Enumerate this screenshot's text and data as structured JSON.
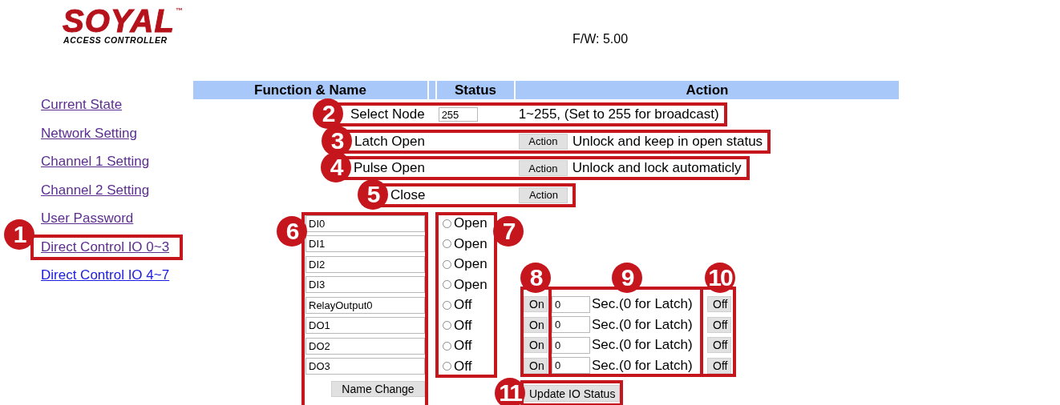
{
  "header": {
    "logo": {
      "brand": "SOYAL",
      "trademark": "™",
      "subtitle": "ACCESS CONTROLLER"
    },
    "firmware": "F/W: 5.00"
  },
  "sidebar": {
    "items": [
      {
        "label": "Current State",
        "visited": true
      },
      {
        "label": "Network Setting",
        "visited": true
      },
      {
        "label": "Channel 1 Setting",
        "visited": true
      },
      {
        "label": "Channel 2 Setting",
        "visited": true
      },
      {
        "label": "User Password",
        "visited": true
      },
      {
        "label": "Direct Control IO 0~3",
        "visited": true,
        "callout": "1"
      },
      {
        "label": "Direct Control IO 4~7",
        "visited": false
      }
    ]
  },
  "table": {
    "columns": [
      "Function & Name",
      "Status",
      "Action"
    ],
    "commands": [
      {
        "kind": "input",
        "label": "Select Node",
        "value": "255",
        "description": "1~255, (Set to 255 for broadcast)",
        "callout": "2"
      },
      {
        "kind": "action",
        "label": "Latch Open",
        "button": "Action",
        "description": "Unlock and keep in open status",
        "callout": "3"
      },
      {
        "kind": "action",
        "label": "Pulse Open",
        "button": "Action",
        "description": "Unlock and lock automaticly",
        "callout": "4"
      },
      {
        "kind": "action",
        "label": "Close",
        "button": "Action",
        "callout": "5"
      }
    ]
  },
  "io": {
    "rows": [
      {
        "kind": "input",
        "name": "DI0",
        "status": "Open",
        "checked": false
      },
      {
        "kind": "input",
        "name": "DI1",
        "status": "Open",
        "checked": false
      },
      {
        "kind": "input",
        "name": "DI2",
        "status": "Open",
        "checked": false
      },
      {
        "kind": "input",
        "name": "DI3",
        "status": "Open",
        "checked": false
      },
      {
        "kind": "output",
        "name": "RelayOutput0",
        "status": "Off",
        "checked": false,
        "on": "On",
        "seconds": "0",
        "unit": "Sec.(0 for Latch)",
        "off": "Off"
      },
      {
        "kind": "output",
        "name": "DO1",
        "status": "Off",
        "checked": false,
        "on": "On",
        "seconds": "0",
        "unit": "Sec.(0 for Latch)",
        "off": "Off"
      },
      {
        "kind": "output",
        "name": "DO2",
        "status": "Off",
        "checked": false,
        "on": "On",
        "seconds": "0",
        "unit": "Sec.(0 for Latch)",
        "off": "Off"
      },
      {
        "kind": "output",
        "name": "DO3",
        "status": "Off",
        "checked": false,
        "on": "On",
        "seconds": "0",
        "unit": "Sec.(0 for Latch)",
        "off": "Off"
      }
    ],
    "name_change": "Name Change",
    "update": "Update IO Status",
    "callouts": {
      "names": "6",
      "status": "7",
      "on": "8",
      "duration": "9",
      "off": "10",
      "update": "11"
    }
  }
}
